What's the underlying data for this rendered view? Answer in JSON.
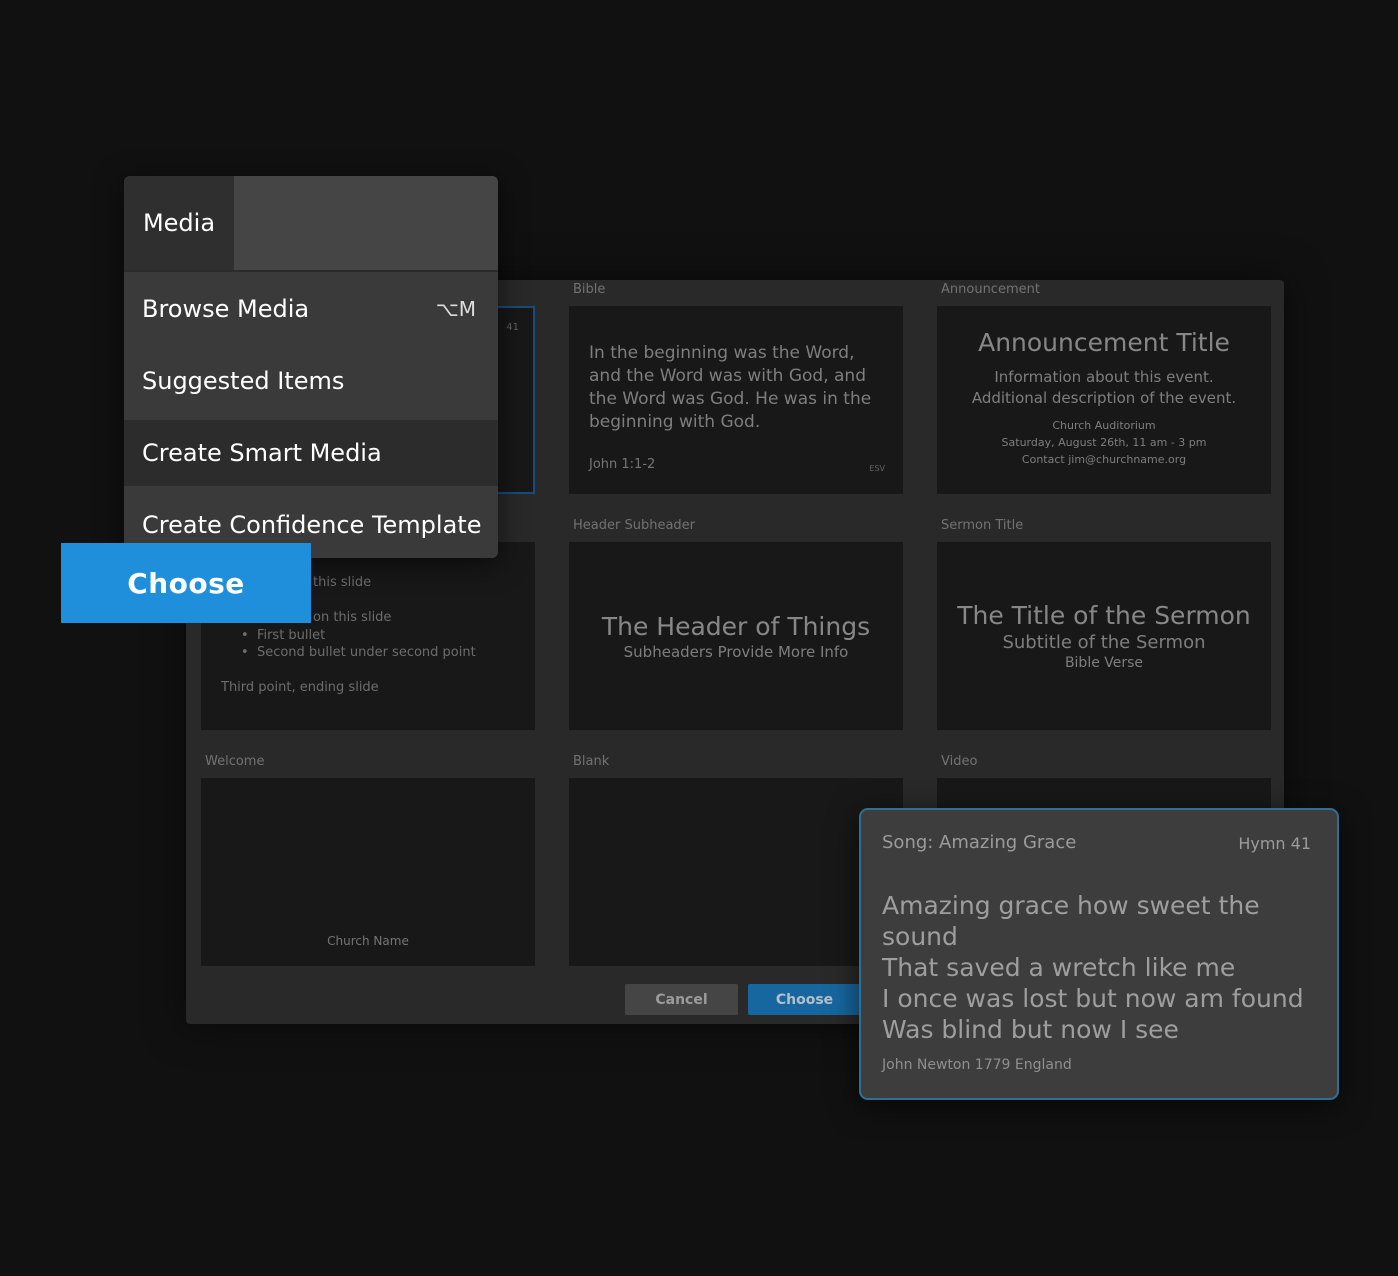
{
  "dialog": {
    "templates": [
      {
        "id": "song",
        "label": "",
        "badge": "41"
      },
      {
        "id": "bible",
        "label": "Bible",
        "body": "In the beginning was the Word, and the Word was with God, and the Word was God.  He was in the beginning with God.",
        "reference": "John 1:1-2",
        "translation": "ESV"
      },
      {
        "id": "announcement",
        "label": "Announcement",
        "title": "Announcement Title",
        "info1": "Information about this event.",
        "info2": "Additional description of the event.",
        "location": "Church Auditorium",
        "when": "Saturday, August 26th, 11 am - 3 pm",
        "contact": "Contact jim@churchname.org"
      },
      {
        "id": "points",
        "label": "",
        "line1": "this slide",
        "line2": "on this slide",
        "bullet1": "First bullet",
        "bullet2": "Second bullet under second point",
        "line3": "Third point, ending slide"
      },
      {
        "id": "header-subheader",
        "label": "Header Subheader",
        "header": "The Header of Things",
        "subheader": "Subheaders Provide More Info"
      },
      {
        "id": "sermon-title",
        "label": "Sermon Title",
        "title": "The Title of the Sermon",
        "subtitle": "Subtitle of the Sermon",
        "verse": "Bible Verse"
      },
      {
        "id": "welcome",
        "label": "Welcome",
        "footer": "Church Name"
      },
      {
        "id": "blank",
        "label": "Blank"
      },
      {
        "id": "video",
        "label": "Video"
      }
    ],
    "cancel_label": "Cancel",
    "choose_label": "Choose"
  },
  "menu": {
    "tab_label": "Media",
    "items": [
      {
        "label": "Browse Media",
        "shortcut": "⌥M"
      },
      {
        "label": "Suggested Items"
      },
      {
        "label": "Create Smart Media"
      },
      {
        "label": "Create Confidence Template"
      }
    ]
  },
  "choose_button": "Choose",
  "song_card": {
    "title": "Song: Amazing Grace",
    "hymn": "Hymn 41",
    "lyrics": [
      "Amazing grace how sweet the sound",
      "That saved a wretch like me",
      "I once was lost but now am found",
      "Was blind but now I see"
    ],
    "credit": "John Newton 1779 England"
  },
  "colors": {
    "accent": "#1f8fdc",
    "selection": "#1c5e9a",
    "song_border": "#2f6f95"
  }
}
